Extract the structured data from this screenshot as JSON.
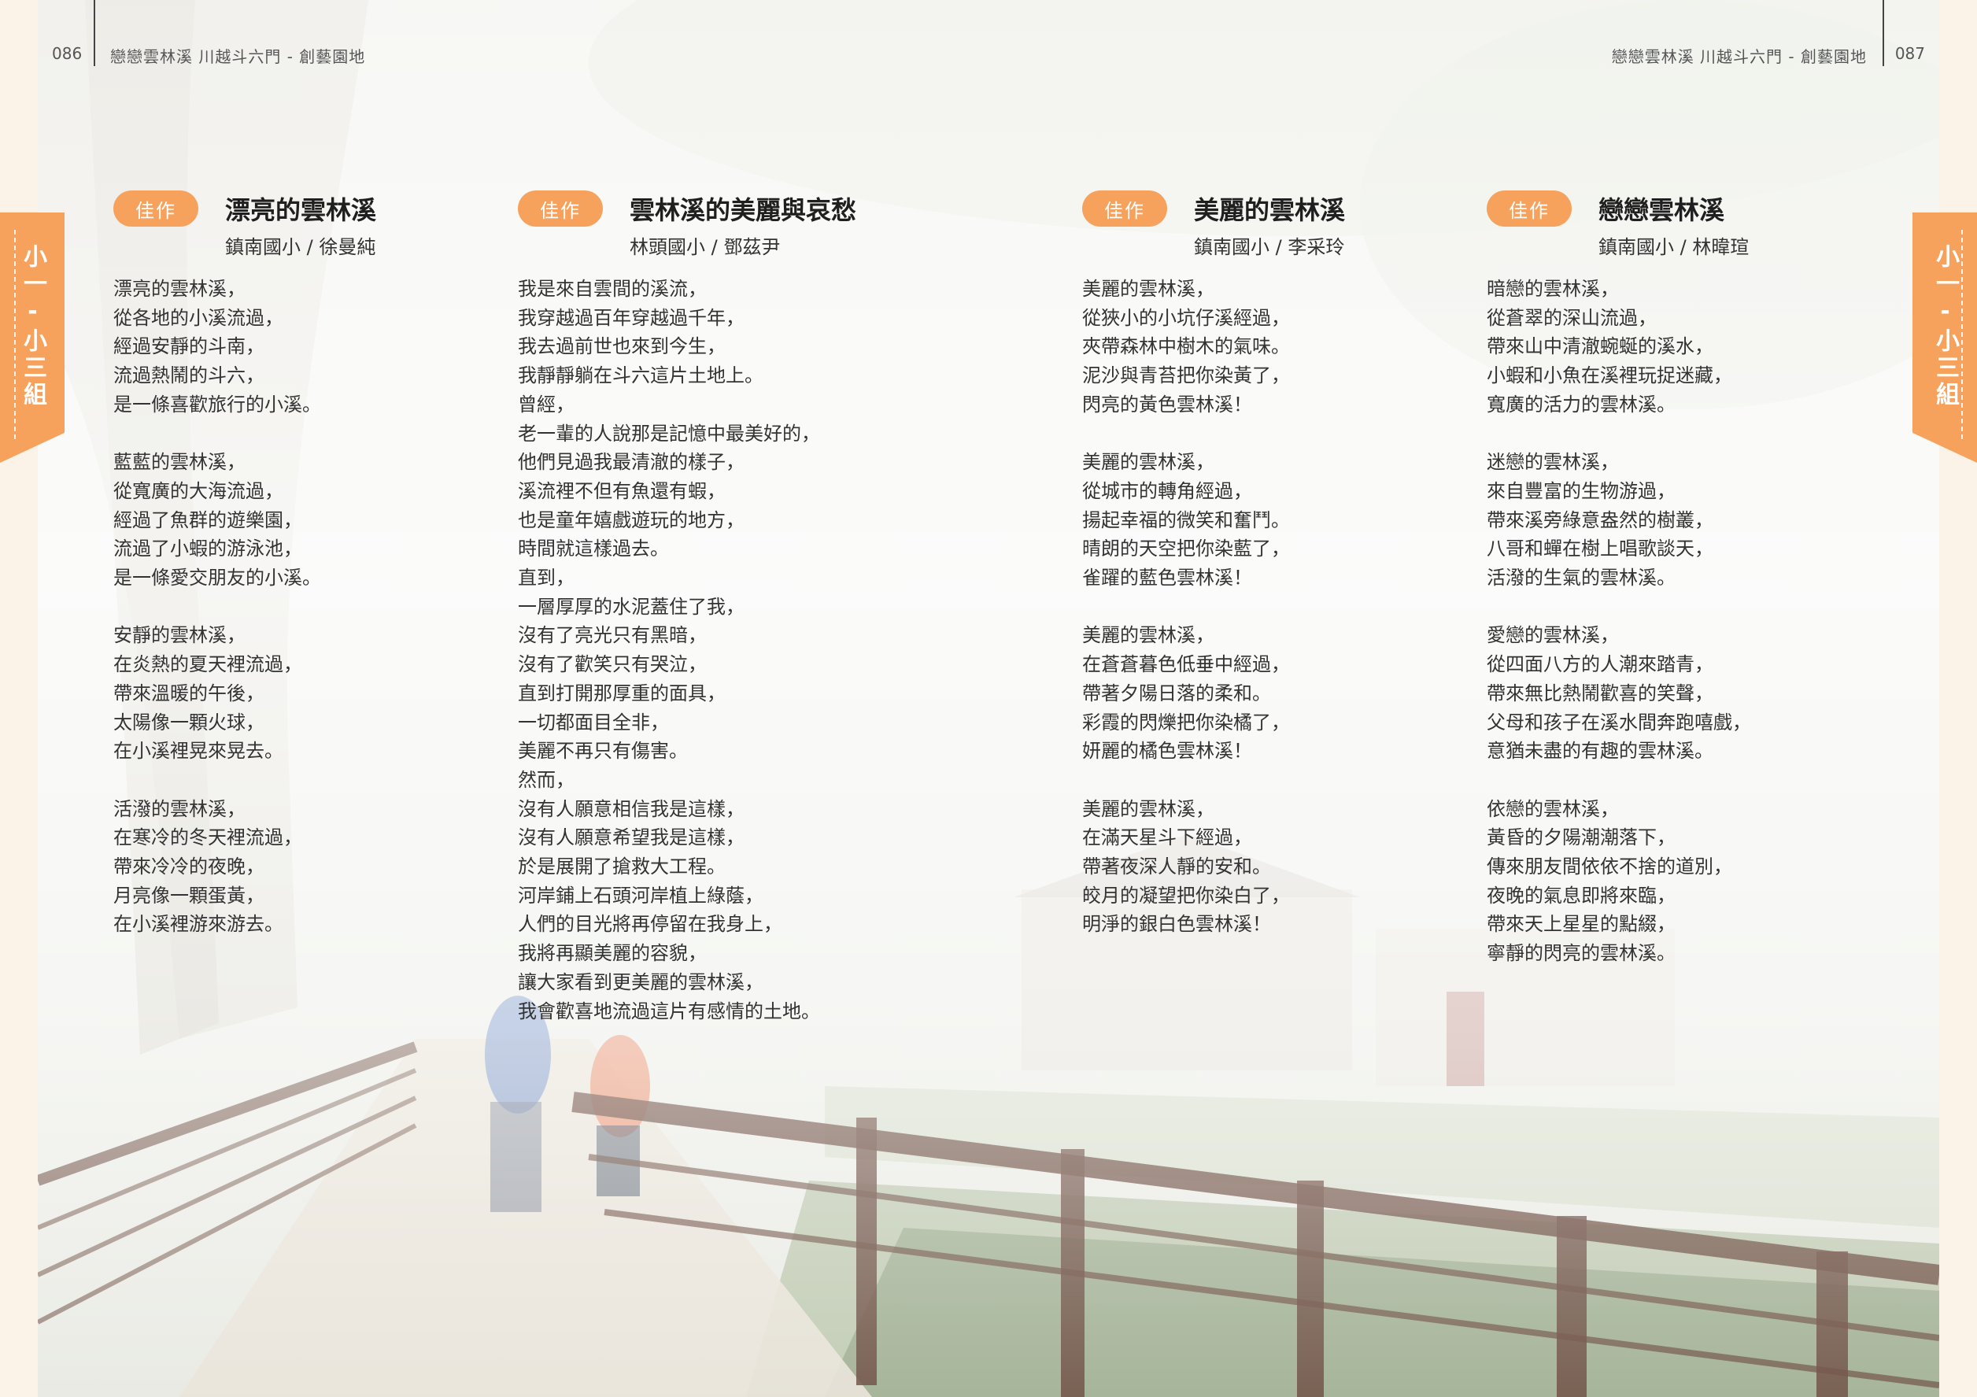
{
  "header": {
    "left_page_number": "086",
    "left_title": "戀戀雲林溪  川越斗六門 - 創藝園地",
    "right_title": "戀戀雲林溪  川越斗六門 - 創藝園地",
    "right_page_number": "087"
  },
  "side_tab": {
    "left_label": "小一-小三組",
    "right_label": "小一-小三組"
  },
  "colors": {
    "accent": "#f7a25c"
  },
  "poems": [
    {
      "badge": "佳作",
      "title": "漂亮的雲林溪",
      "author": "鎮南國小 / 徐曼純",
      "lines": [
        "漂亮的雲林溪，",
        "從各地的小溪流過，",
        "經過安靜的斗南，",
        "流過熱鬧的斗六，",
        "是一條喜歡旅行的小溪。",
        "",
        "藍藍的雲林溪，",
        "從寬廣的大海流過，",
        "經過了魚群的遊樂園，",
        "流過了小蝦的游泳池，",
        "是一條愛交朋友的小溪。",
        "",
        "安靜的雲林溪，",
        "在炎熱的夏天裡流過，",
        "帶來溫暖的午後，",
        "太陽像一顆火球，",
        "在小溪裡晃來晃去。",
        "",
        "活潑的雲林溪，",
        "在寒冷的冬天裡流過，",
        "帶來冷冷的夜晚，",
        "月亮像一顆蛋黃，",
        "在小溪裡游來游去。"
      ]
    },
    {
      "badge": "佳作",
      "title": "雲林溪的美麗與哀愁",
      "author": "林頭國小 / 鄧茲尹",
      "lines": [
        "我是來自雲間的溪流，",
        "我穿越過百年穿越過千年，",
        "我去過前世也來到今生，",
        "我靜靜躺在斗六這片土地上。",
        "曾經，",
        "老一輩的人說那是記憶中最美好的，",
        "他們見過我最清澈的樣子，",
        "溪流裡不但有魚還有蝦，",
        "也是童年嬉戲遊玩的地方，",
        "時間就這樣過去。",
        "直到，",
        "一層厚厚的水泥蓋住了我，",
        "沒有了亮光只有黑暗，",
        "沒有了歡笑只有哭泣，",
        "直到打開那厚重的面具，",
        "一切都面目全非，",
        "美麗不再只有傷害。",
        "然而，",
        "沒有人願意相信我是這樣，",
        "沒有人願意希望我是這樣，",
        "於是展開了搶救大工程。",
        "河岸鋪上石頭河岸植上綠蔭，",
        "人們的目光將再停留在我身上，",
        "我將再顯美麗的容貌，",
        "讓大家看到更美麗的雲林溪，",
        "我會歡喜地流過這片有感情的土地。"
      ]
    },
    {
      "badge": "佳作",
      "title": "美麗的雲林溪",
      "author": "鎮南國小 / 李采玲",
      "lines": [
        "美麗的雲林溪，",
        "從狹小的小坑仔溪經過，",
        "夾帶森林中樹木的氣味。",
        "泥沙與青苔把你染黃了，",
        "閃亮的黃色雲林溪！",
        "",
        "美麗的雲林溪，",
        "從城市的轉角經過，",
        "揚起幸福的微笑和奮鬥。",
        "晴朗的天空把你染藍了，",
        "雀躍的藍色雲林溪！",
        "",
        "美麗的雲林溪，",
        "在蒼蒼暮色低垂中經過，",
        "帶著夕陽日落的柔和。",
        "彩霞的閃爍把你染橘了，",
        "妍麗的橘色雲林溪！",
        "",
        "美麗的雲林溪，",
        "在滿天星斗下經過，",
        "帶著夜深人靜的安和。",
        "皎月的凝望把你染白了，",
        "明淨的銀白色雲林溪！"
      ]
    },
    {
      "badge": "佳作",
      "title": "戀戀雲林溪",
      "author": "鎮南國小 / 林暐瑄",
      "lines": [
        "暗戀的雲林溪，",
        "從蒼翠的深山流過，",
        "帶來山中清澈蜿蜒的溪水，",
        "小蝦和小魚在溪裡玩捉迷藏，",
        "寬廣的活力的雲林溪。",
        "",
        "迷戀的雲林溪，",
        "來自豐富的生物游過，",
        "帶來溪旁綠意盎然的樹叢，",
        "八哥和蟬在樹上唱歌談天，",
        "活潑的生氣的雲林溪。",
        "",
        "愛戀的雲林溪，",
        "從四面八方的人潮來踏青，",
        "帶來無比熱鬧歡喜的笑聲，",
        "父母和孩子在溪水間奔跑嘻戲，",
        "意猶未盡的有趣的雲林溪。",
        "",
        "依戀的雲林溪，",
        "黃昏的夕陽潮潮落下，",
        "傳來朋友間依依不捨的道別，",
        "夜晚的氣息即將來臨，",
        "帶來天上星星的點綴，",
        "寧靜的閃亮的雲林溪。"
      ]
    }
  ]
}
